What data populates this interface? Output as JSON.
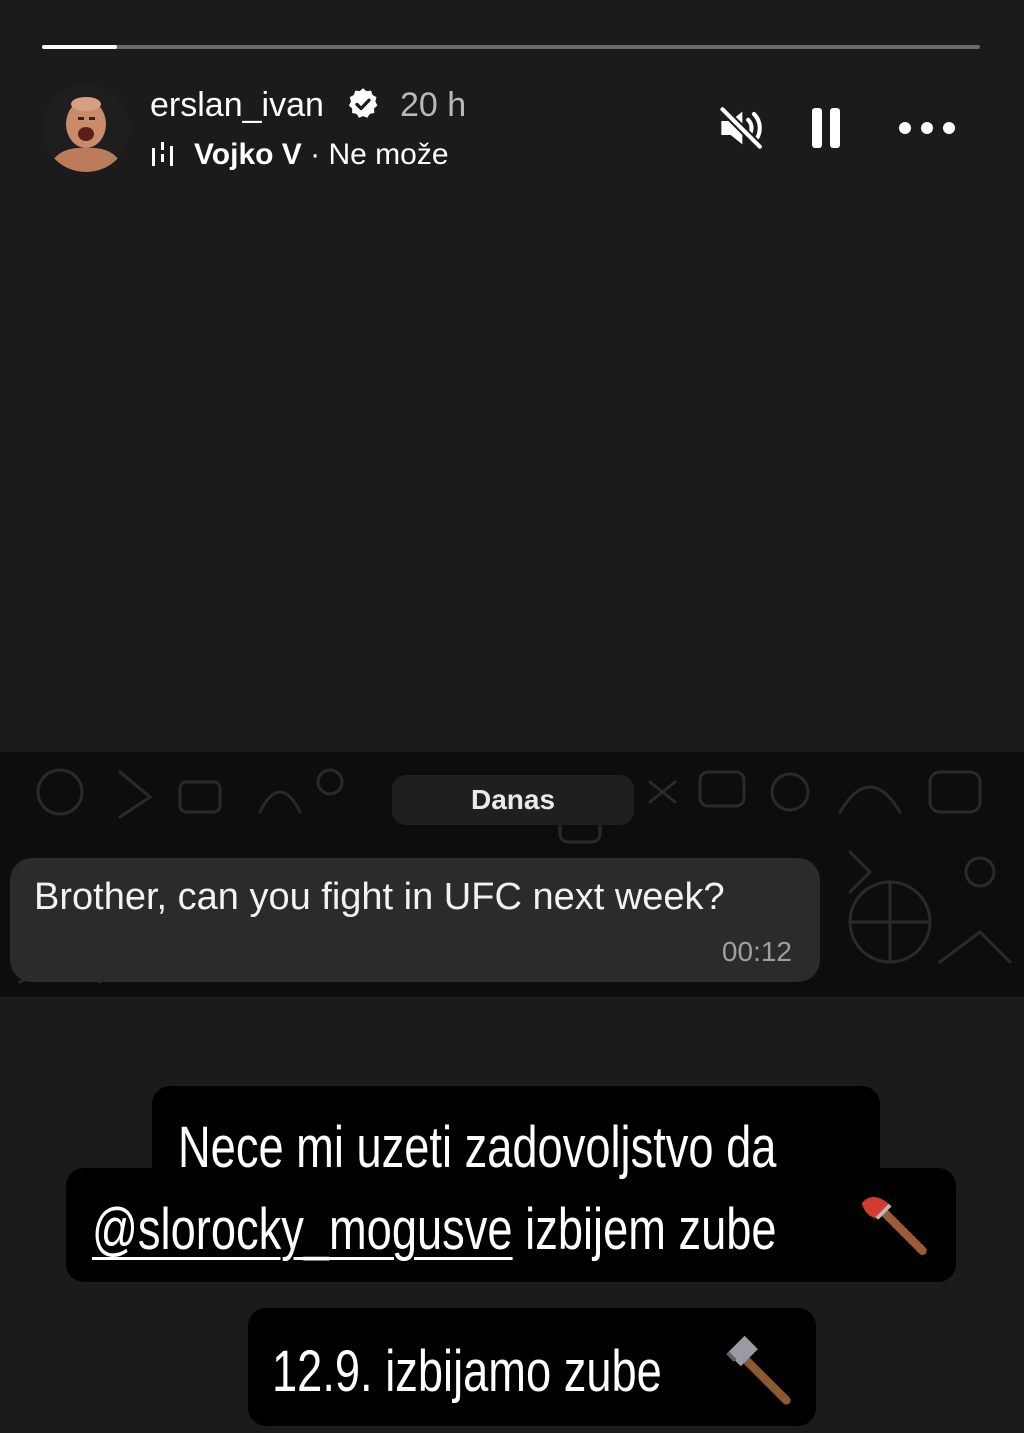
{
  "story": {
    "progress_fraction": 0.08,
    "user": {
      "username": "erslan_ivan",
      "verified_icon": "verified-badge-icon",
      "time_ago": "20 h"
    },
    "music": {
      "icon": "music-bars-icon",
      "artist": "Vojko V",
      "separator": " · ",
      "track": "Ne može"
    },
    "controls": {
      "mute_icon": "speaker-muted-icon",
      "pause_icon": "pause-icon",
      "more_icon": "more-dots-icon"
    }
  },
  "chat": {
    "day_label": "Danas",
    "message": {
      "text": "Brother, can you fight in UFC next week?",
      "time": "00:12"
    }
  },
  "captions": {
    "line1": "Nece mi uzeti zadovoljstvo da",
    "mention": "@slorocky_mogusve",
    "line2_rest": " izbijem zube",
    "line2_emoji": "axe-icon",
    "line3": "12.9. izbijamo zube",
    "line3_emoji": "hammer-icon"
  }
}
